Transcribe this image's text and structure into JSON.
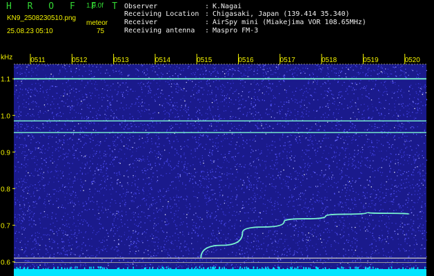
{
  "app": {
    "name": "H R O F F T",
    "version": "1.0.0f",
    "filename": "KN9_2508230510.png",
    "datetime": "25.08.23 05:10",
    "meteor_label": "meteor",
    "meteor_count": "75"
  },
  "info": [
    {
      "label": "Observer",
      "value": "K.Nagai"
    },
    {
      "label": "Receiving Location",
      "value": "Chigasaki, Japan (139.414 35.340)"
    },
    {
      "label": "Receiver",
      "value": "AirSpy mini (Miakejima VOR 108.65MHz)"
    },
    {
      "label": "Receiving antenna",
      "value": "Maspro FM-3"
    }
  ],
  "colors": {
    "background": "#000000",
    "plot_noise_base": "#1a1a8c",
    "axis_text": "#f2f200",
    "header_green": "#33d633",
    "header_white": "#f0f0f0",
    "echo_trace": "#7fffd4",
    "bottom_band": "#00e5ff"
  },
  "chart_data": {
    "type": "heatmap",
    "ylabel": "kHz",
    "y_ticks": [
      "1.1",
      "1.0",
      "0.9",
      "0.8",
      "0.7",
      "0.6"
    ],
    "x_ticks": [
      "0511",
      "0512",
      "0513",
      "0514",
      "0515",
      "0516",
      "0517",
      "0518",
      "0519",
      "0520"
    ],
    "ylim": [
      0.58,
      1.14
    ],
    "grid": false,
    "signals": [
      {
        "name": "Steady carrier",
        "frequency_khz": 1.1
      },
      {
        "name": "Steady carrier",
        "frequency_khz": 0.985
      },
      {
        "name": "Steady carrier",
        "frequency_khz": 0.953
      },
      {
        "name": "Steady carrier",
        "frequency_khz": 0.61
      },
      {
        "name": "Meteor echo",
        "start": [
          "0515",
          0.61
        ],
        "points": [
          [
            "0515",
            0.61
          ],
          [
            "0516",
            0.68
          ],
          [
            "0517",
            0.71
          ],
          [
            "0518",
            0.725
          ],
          [
            "0519",
            0.735
          ],
          [
            "0520",
            0.73
          ]
        ]
      }
    ]
  }
}
